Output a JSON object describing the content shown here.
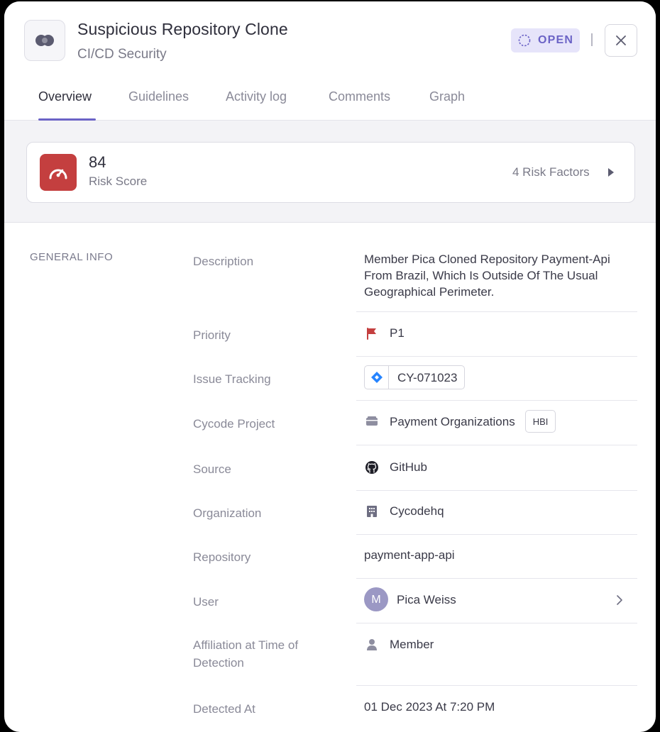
{
  "header": {
    "title": "Suspicious Repository Clone",
    "subtitle": "CI/CD Security",
    "status": "OPEN",
    "close_icon": "close-icon"
  },
  "tabs": [
    {
      "label": "Overview",
      "active": true
    },
    {
      "label": "Guidelines",
      "active": false
    },
    {
      "label": "Activity log",
      "active": false
    },
    {
      "label": "Comments",
      "active": false
    },
    {
      "label": "Graph",
      "active": false
    }
  ],
  "risk": {
    "score": "84",
    "label": "Risk Score",
    "factors": "4 Risk Factors",
    "icon": "gauge-icon",
    "color": "#c43f3f"
  },
  "general_info": {
    "title": "GENERAL INFO",
    "rows": [
      {
        "label": "Description",
        "value": "Member Pica Cloned Repository Payment-Api From Brazil, Which Is Outside Of The Usual Geographical Perimeter."
      },
      {
        "label": "Priority",
        "value": "P1",
        "icon": "flag-icon"
      },
      {
        "label": "Issue Tracking",
        "value": "CY-071023",
        "icon": "jira-icon"
      },
      {
        "label": "Cycode Project",
        "value": "Payment Organizations",
        "tag": "HBI",
        "icon": "project-icon"
      },
      {
        "label": "Source",
        "value": "GitHub",
        "icon": "github-icon"
      },
      {
        "label": "Organization",
        "value": "Cycodehq",
        "icon": "building-icon"
      },
      {
        "label": "Repository",
        "value": "payment-app-api"
      },
      {
        "label": "User",
        "value": "Pica Weiss",
        "avatar": "M"
      },
      {
        "label": "Affiliation at Time of Detection",
        "value": "Member",
        "icon": "person-icon"
      },
      {
        "label": "Detected At",
        "value": "01 Dec 2023 At 7:20 PM"
      }
    ]
  },
  "colors": {
    "accent": "#6b63c6",
    "status_bg": "#e6e4fa",
    "priority_flag": "#c43f3f",
    "jira_blue": "#2684ff"
  }
}
